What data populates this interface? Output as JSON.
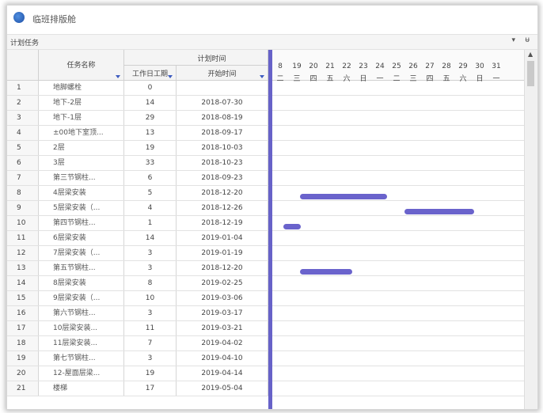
{
  "window": {
    "title": "临班排版舱"
  },
  "panel": {
    "title": "计划任务",
    "dropdown_icon": "▾",
    "pin_icon": "ᵾ"
  },
  "columns": {
    "name": "任务名称",
    "plan_group": "计划时间",
    "days": "工作日工期",
    "start": "开始时间"
  },
  "timeline": {
    "days": [
      "8",
      "19",
      "20",
      "21",
      "22",
      "23",
      "24",
      "25",
      "26",
      "27",
      "28",
      "29",
      "30",
      "31"
    ],
    "weekdays": [
      "二",
      "三",
      "四",
      "五",
      "六",
      "日",
      "一",
      "二",
      "三",
      "四",
      "五",
      "六",
      "日",
      "一"
    ]
  },
  "tasks": [
    {
      "id": "1",
      "name": "地脚螺栓",
      "days": "0",
      "start": ""
    },
    {
      "id": "2",
      "name": "地下-2层",
      "days": "14",
      "start": "2018-07-30"
    },
    {
      "id": "3",
      "name": "地下-1层",
      "days": "29",
      "start": "2018-08-19"
    },
    {
      "id": "4",
      "name": "±00地下室顶...",
      "days": "13",
      "start": "2018-09-17"
    },
    {
      "id": "5",
      "name": "2层",
      "days": "19",
      "start": "2018-10-03"
    },
    {
      "id": "6",
      "name": "3层",
      "days": "33",
      "start": "2018-10-23"
    },
    {
      "id": "7",
      "name": "第三节钢柱...",
      "days": "6",
      "start": "2018-09-23"
    },
    {
      "id": "8",
      "name": "4层梁安装",
      "days": "5",
      "start": "2018-12-20"
    },
    {
      "id": "9",
      "name": "5层梁安装（...",
      "days": "4",
      "start": "2018-12-26"
    },
    {
      "id": "10",
      "name": "第四节钢柱...",
      "days": "1",
      "start": "2018-12-19"
    },
    {
      "id": "11",
      "name": "6层梁安装",
      "days": "14",
      "start": "2019-01-04"
    },
    {
      "id": "12",
      "name": "7层梁安装（...",
      "days": "3",
      "start": "2019-01-19"
    },
    {
      "id": "13",
      "name": "第五节钢柱...",
      "days": "3",
      "start": "2018-12-20"
    },
    {
      "id": "14",
      "name": "8层梁安装",
      "days": "8",
      "start": "2019-02-25"
    },
    {
      "id": "15",
      "name": "9层梁安装（...",
      "days": "10",
      "start": "2019-03-06"
    },
    {
      "id": "16",
      "name": "第六节钢柱...",
      "days": "3",
      "start": "2019-03-17"
    },
    {
      "id": "17",
      "name": "10层梁安装...",
      "days": "11",
      "start": "2019-03-21"
    },
    {
      "id": "18",
      "name": "11层梁安装...",
      "days": "7",
      "start": "2019-04-02"
    },
    {
      "id": "19",
      "name": "第七节钢柱...",
      "days": "3",
      "start": "2019-04-10"
    },
    {
      "id": "20",
      "name": "12-屋面层梁...",
      "days": "19",
      "start": "2019-04-14"
    },
    {
      "id": "21",
      "name": "楼梯",
      "days": "17",
      "start": "2019-05-04"
    }
  ],
  "colors": {
    "bar": "#6a63cc",
    "accent": "#3d5bbf"
  }
}
